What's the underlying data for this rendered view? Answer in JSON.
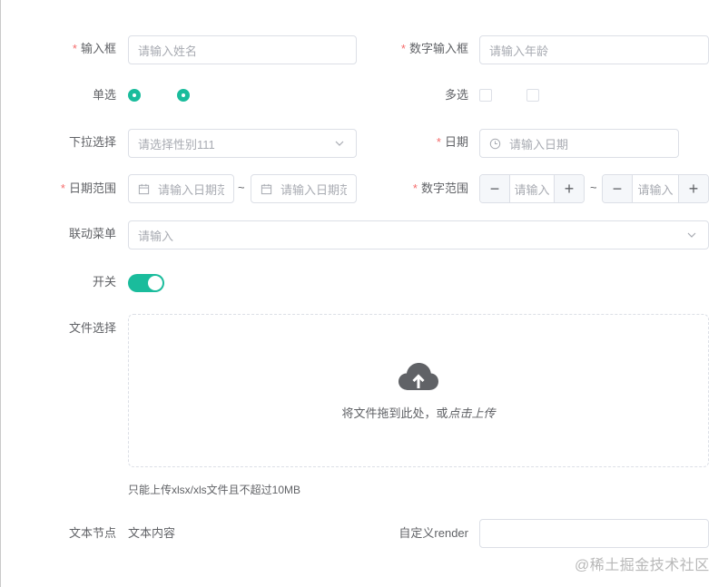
{
  "form": {
    "name": {
      "label": "输入框",
      "placeholder": "请输入姓名"
    },
    "age": {
      "label": "数字输入框",
      "placeholder": "请输入年龄"
    },
    "radio": {
      "label": "单选"
    },
    "checkbox": {
      "label": "多选"
    },
    "select": {
      "label": "下拉选择",
      "placeholder": "请选择性别111"
    },
    "date": {
      "label": "日期",
      "placeholder": "请输入日期"
    },
    "date_range": {
      "label": "日期范围",
      "start_placeholder": "请输入日期范",
      "separator": "~",
      "end_placeholder": "请输入日期范"
    },
    "number_range": {
      "label": "数字范围",
      "min_placeholder": "请输入",
      "max_placeholder": "请输入",
      "separator": "~",
      "minus": "−",
      "plus": "+"
    },
    "cascader": {
      "label": "联动菜单",
      "placeholder": "请输入"
    },
    "switch": {
      "label": "开关",
      "on": true
    },
    "upload": {
      "label": "文件选择",
      "text": "将文件拖到此处，或",
      "link": "点击上传",
      "tip": "只能上传xlsx/xls文件且不超过10MB"
    },
    "text_node": {
      "label": "文本节点",
      "value": "文本内容"
    },
    "custom_render": {
      "label": "自定义render",
      "value": ""
    }
  },
  "watermark": "@稀土掘金技术社区",
  "colors": {
    "accent": "#1abc9c",
    "required": "#f56c6c",
    "border": "#dcdfe6"
  }
}
